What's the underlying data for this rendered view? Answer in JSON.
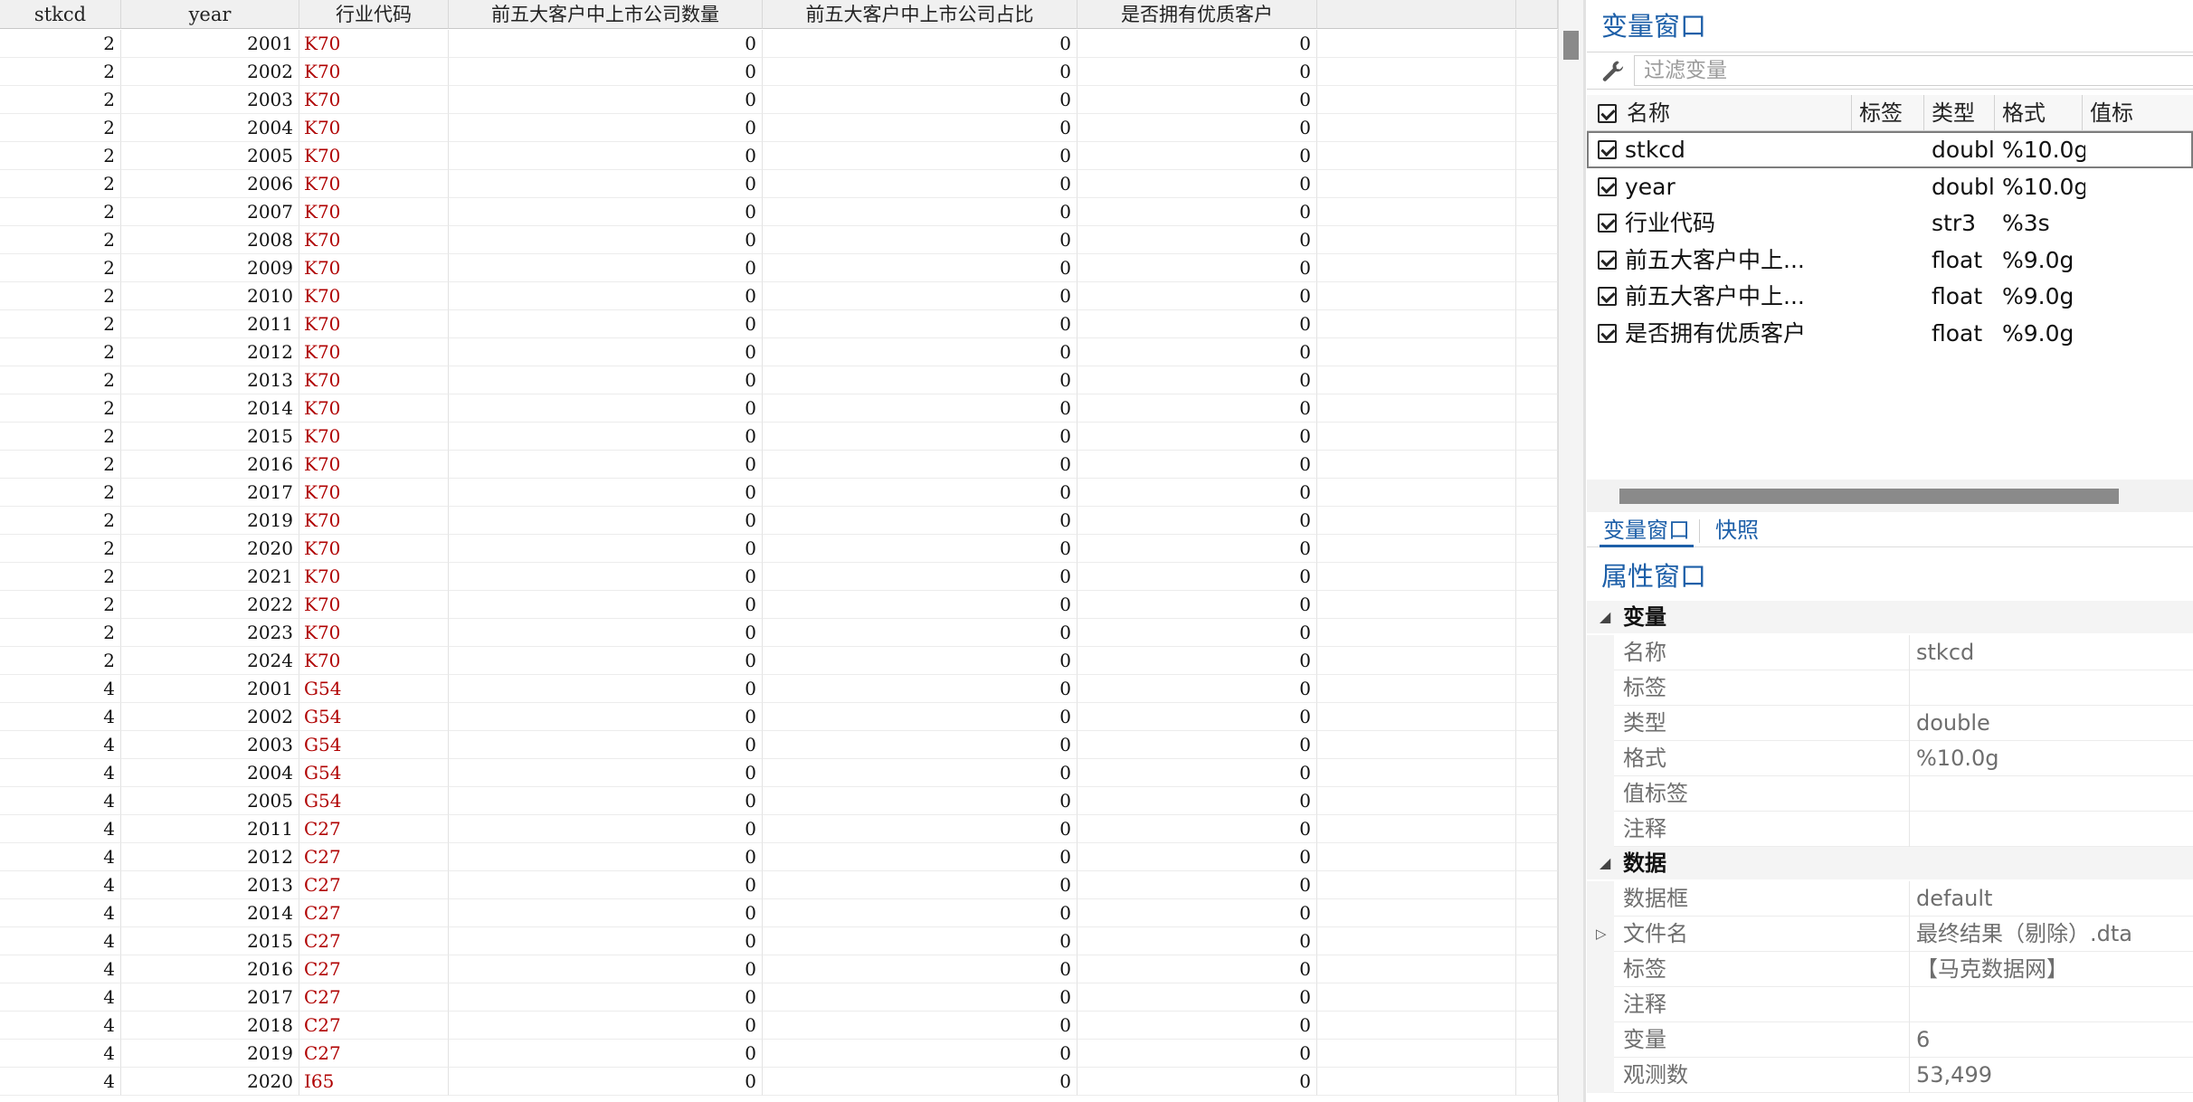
{
  "grid": {
    "columns": [
      "stkcd",
      "year",
      "行业代码",
      "前五大客户中上市公司数量",
      "前五大客户中上市公司占比",
      "是否拥有优质客户"
    ],
    "rows": [
      [
        "2",
        "2001",
        "K70",
        "0",
        "0",
        "0"
      ],
      [
        "2",
        "2002",
        "K70",
        "0",
        "0",
        "0"
      ],
      [
        "2",
        "2003",
        "K70",
        "0",
        "0",
        "0"
      ],
      [
        "2",
        "2004",
        "K70",
        "0",
        "0",
        "0"
      ],
      [
        "2",
        "2005",
        "K70",
        "0",
        "0",
        "0"
      ],
      [
        "2",
        "2006",
        "K70",
        "0",
        "0",
        "0"
      ],
      [
        "2",
        "2007",
        "K70",
        "0",
        "0",
        "0"
      ],
      [
        "2",
        "2008",
        "K70",
        "0",
        "0",
        "0"
      ],
      [
        "2",
        "2009",
        "K70",
        "0",
        "0",
        "0"
      ],
      [
        "2",
        "2010",
        "K70",
        "0",
        "0",
        "0"
      ],
      [
        "2",
        "2011",
        "K70",
        "0",
        "0",
        "0"
      ],
      [
        "2",
        "2012",
        "K70",
        "0",
        "0",
        "0"
      ],
      [
        "2",
        "2013",
        "K70",
        "0",
        "0",
        "0"
      ],
      [
        "2",
        "2014",
        "K70",
        "0",
        "0",
        "0"
      ],
      [
        "2",
        "2015",
        "K70",
        "0",
        "0",
        "0"
      ],
      [
        "2",
        "2016",
        "K70",
        "0",
        "0",
        "0"
      ],
      [
        "2",
        "2017",
        "K70",
        "0",
        "0",
        "0"
      ],
      [
        "2",
        "2019",
        "K70",
        "0",
        "0",
        "0"
      ],
      [
        "2",
        "2020",
        "K70",
        "0",
        "0",
        "0"
      ],
      [
        "2",
        "2021",
        "K70",
        "0",
        "0",
        "0"
      ],
      [
        "2",
        "2022",
        "K70",
        "0",
        "0",
        "0"
      ],
      [
        "2",
        "2023",
        "K70",
        "0",
        "0",
        "0"
      ],
      [
        "2",
        "2024",
        "K70",
        "0",
        "0",
        "0"
      ],
      [
        "4",
        "2001",
        "G54",
        "0",
        "0",
        "0"
      ],
      [
        "4",
        "2002",
        "G54",
        "0",
        "0",
        "0"
      ],
      [
        "4",
        "2003",
        "G54",
        "0",
        "0",
        "0"
      ],
      [
        "4",
        "2004",
        "G54",
        "0",
        "0",
        "0"
      ],
      [
        "4",
        "2005",
        "G54",
        "0",
        "0",
        "0"
      ],
      [
        "4",
        "2011",
        "C27",
        "0",
        "0",
        "0"
      ],
      [
        "4",
        "2012",
        "C27",
        "0",
        "0",
        "0"
      ],
      [
        "4",
        "2013",
        "C27",
        "0",
        "0",
        "0"
      ],
      [
        "4",
        "2014",
        "C27",
        "0",
        "0",
        "0"
      ],
      [
        "4",
        "2015",
        "C27",
        "0",
        "0",
        "0"
      ],
      [
        "4",
        "2016",
        "C27",
        "0",
        "0",
        "0"
      ],
      [
        "4",
        "2017",
        "C27",
        "0",
        "0",
        "0"
      ],
      [
        "4",
        "2018",
        "C27",
        "0",
        "0",
        "0"
      ],
      [
        "4",
        "2019",
        "C27",
        "0",
        "0",
        "0"
      ],
      [
        "4",
        "2020",
        "I65",
        "0",
        "0",
        "0"
      ]
    ]
  },
  "variables_window": {
    "title": "变量窗口",
    "filter_placeholder": "过滤变量",
    "columns": [
      "名称",
      "标签",
      "类型",
      "格式",
      "值标"
    ],
    "variables": [
      {
        "name": "stkcd",
        "label": "",
        "type": "double",
        "format": "%10.0g"
      },
      {
        "name": "year",
        "label": "",
        "type": "double",
        "format": "%10.0g"
      },
      {
        "name": "行业代码",
        "label": "",
        "type": "str3",
        "format": "%3s"
      },
      {
        "name": "前五大客户中上...",
        "label": "",
        "type": "float",
        "format": "%9.0g"
      },
      {
        "name": "前五大客户中上...",
        "label": "",
        "type": "float",
        "format": "%9.0g"
      },
      {
        "name": "是否拥有优质客户",
        "label": "",
        "type": "float",
        "format": "%9.0g"
      }
    ]
  },
  "tabs": [
    "变量窗口",
    "快照"
  ],
  "properties_window": {
    "title": "属性窗口",
    "sections": [
      {
        "name": "变量",
        "rows": [
          {
            "key": "名称",
            "value": "stkcd"
          },
          {
            "key": "标签",
            "value": ""
          },
          {
            "key": "类型",
            "value": "double"
          },
          {
            "key": "格式",
            "value": "%10.0g"
          },
          {
            "key": "值标签",
            "value": ""
          },
          {
            "key": "注释",
            "value": ""
          }
        ]
      },
      {
        "name": "数据",
        "rows": [
          {
            "key": "数据框",
            "value": "default"
          },
          {
            "key": "文件名",
            "value": "最终结果（剔除）.dta"
          },
          {
            "key": "标签",
            "value": "【马克数据网】"
          },
          {
            "key": "注释",
            "value": ""
          },
          {
            "key": "变量",
            "value": "6"
          },
          {
            "key": "观测数",
            "value": "53,499"
          }
        ]
      }
    ]
  }
}
